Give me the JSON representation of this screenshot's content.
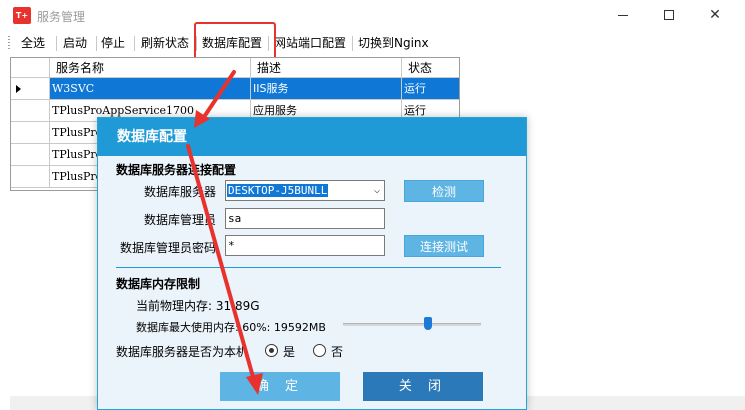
{
  "window": {
    "title": "服务管理",
    "icon_text": "T+",
    "icon_color": "#e8322e"
  },
  "toolbar": {
    "items": [
      "全选",
      "启动",
      "停止",
      "刷新状态",
      "数据库配置",
      "网站端口配置",
      "切换到Nginx"
    ]
  },
  "grid": {
    "columns": [
      "服务名称",
      "描述",
      "状态"
    ],
    "rows": [
      {
        "name": "W3SVC",
        "desc": "IIS服务",
        "status": "运行",
        "selected": true
      },
      {
        "name": "TPlusProAppService1700",
        "desc": "应用服务",
        "status": "运行"
      },
      {
        "name": "TPlusPro",
        "desc": "",
        "status": ""
      },
      {
        "name": "TPlusPro",
        "desc": "",
        "status": ""
      },
      {
        "name": "TPlusPro",
        "desc": "",
        "status": ""
      }
    ]
  },
  "dialog": {
    "title": "数据库配置",
    "section_conn": "数据库服务器连接配置",
    "server_label": "数据库服务器",
    "server_value": "DESKTOP-J5BUNLL",
    "detect_button": "检测",
    "admin_label": "数据库管理员",
    "admin_value": "sa",
    "password_label": "数据库管理员密码",
    "password_value": "*",
    "test_button": "连接测试",
    "section_mem": "数据库内存限制",
    "physical_mem": "当前物理内存: 31.89G",
    "max_mem": "数据库最大使用内存: 60%: 19592MB",
    "max_mem_percent": 60,
    "local_question": "数据库服务器是否为本机",
    "yes_label": "是",
    "no_label": "否",
    "local_is_yes": true,
    "ok_button": "确 定",
    "close_button": "关 闭"
  },
  "colors": {
    "accent": "#1f9ad6",
    "selected_row": "#0f78d7",
    "ok_button": "#5eb4e2",
    "close_button": "#2b79b8",
    "annotation": "#e8322e"
  }
}
